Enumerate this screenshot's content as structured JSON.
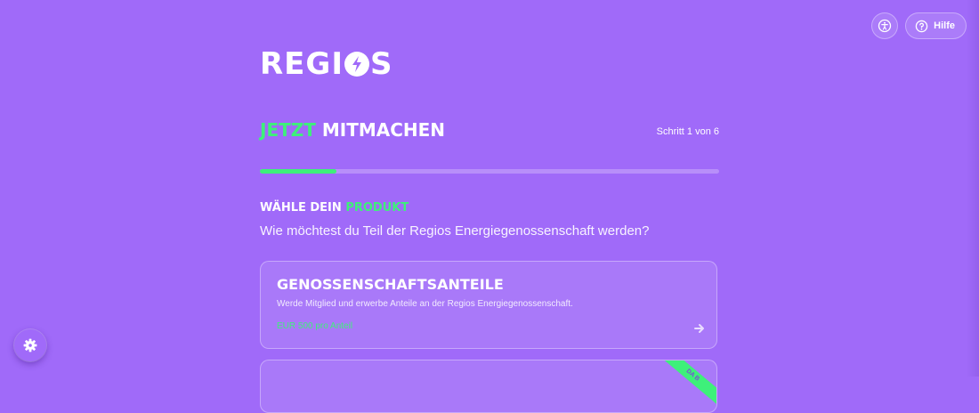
{
  "topbar": {
    "accessibility_icon": "accessibility-icon",
    "help_icon": "help-circle-icon",
    "help_label": "Hilfe"
  },
  "logo": {
    "pre": "REGI",
    "post": "S",
    "icon": "lightning-bolt-icon"
  },
  "header": {
    "title_accent": "JETZT",
    "title_rest": " MITMACHEN",
    "step": "Schritt 1 von 6"
  },
  "progress": {
    "current_step": 1,
    "total_steps": 6
  },
  "section": {
    "heading_pre": "WÄHLE DEIN ",
    "heading_accent": "PRODUKT",
    "question": "Wie möchtest du Teil der Regios Energiegenossenschaft werden?"
  },
  "cards": [
    {
      "title": "GENOSSENSCHAFTSANTEILE",
      "description": "Werde Mitglied und erwerbe Anteile an der Regios Energiegenossenschaft.",
      "price": "EUR 500 pro Anteil",
      "icon": "arrow-right-icon"
    },
    {
      "ribbon": "DA B"
    }
  ],
  "fab": {
    "icon": "gear-icon"
  },
  "colors": {
    "background": "#a06af9",
    "accent": "#3ef07a",
    "text": "#ffffff"
  }
}
